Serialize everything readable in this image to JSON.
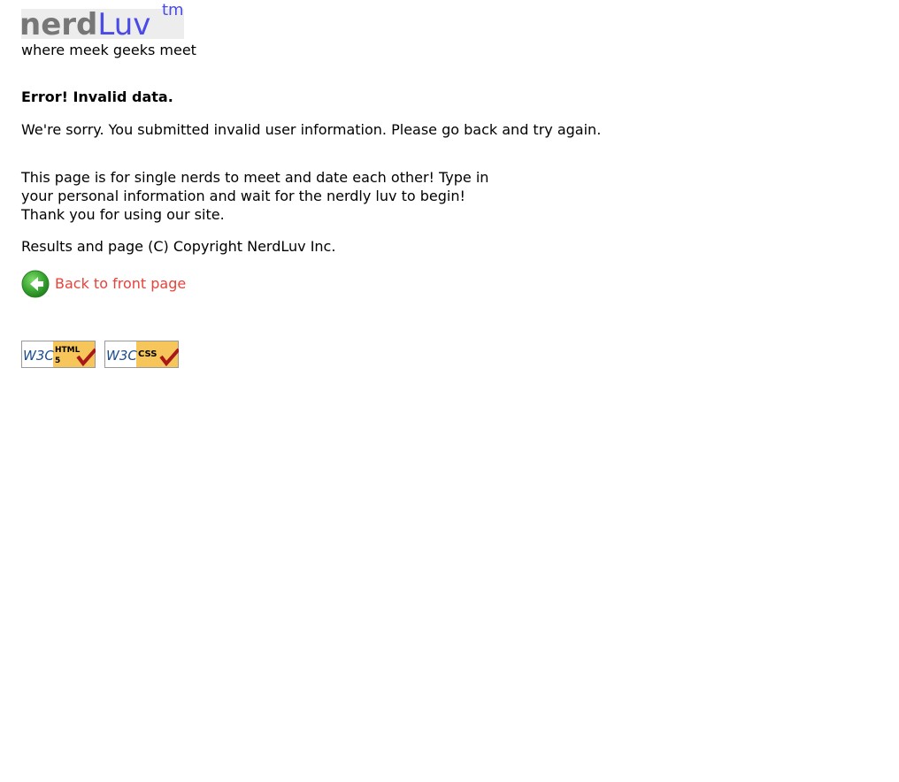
{
  "logo": {
    "nerd": "nerd",
    "luv": "Luv",
    "tm": "tm"
  },
  "tagline": "where meek geeks meet",
  "error": {
    "title": "Error! Invalid data.",
    "message": "We're sorry. You submitted invalid user information. Please go back and try again."
  },
  "about": {
    "line1": "This page is for single nerds to meet and date each other! Type in",
    "line2": "your personal information and wait for the nerdly luv to begin!",
    "line3": "Thank you for using our site."
  },
  "copyright": "Results and page (C) Copyright NerdLuv Inc.",
  "back_link": {
    "label": "Back to front page",
    "icon": "back-arrow-icon"
  },
  "badges": {
    "w3c_logo": "W3C",
    "html_text": "HTML",
    "html_version": "5",
    "css_text": "CSS"
  },
  "colors": {
    "logo_gray": "#777777",
    "logo_blue": "#4a4ae8",
    "link_red": "#e8423a",
    "badge_yellow": "#f7c65b",
    "check_red": "#a81818"
  }
}
